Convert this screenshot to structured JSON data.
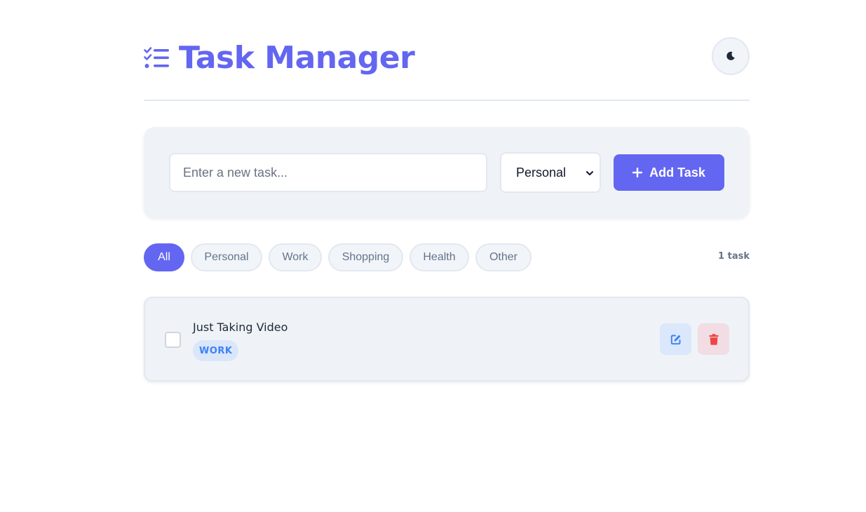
{
  "header": {
    "title": "Task Manager",
    "title_icon": "task-list-icon",
    "theme_toggle_icon": "moon-icon"
  },
  "add_task": {
    "input_placeholder": "Enter a new task...",
    "input_value": "",
    "category_selected": "Personal",
    "button_label": "Add Task",
    "button_icon": "plus-icon"
  },
  "filters": {
    "items": [
      {
        "label": "All",
        "active": true
      },
      {
        "label": "Personal",
        "active": false
      },
      {
        "label": "Work",
        "active": false
      },
      {
        "label": "Shopping",
        "active": false
      },
      {
        "label": "Health",
        "active": false
      },
      {
        "label": "Other",
        "active": false
      }
    ],
    "task_count": "1 task"
  },
  "tasks": [
    {
      "title": "Just Taking Video",
      "category": "WORK",
      "completed": false,
      "edit_icon": "edit-icon",
      "delete_icon": "trash-icon"
    }
  ],
  "colors": {
    "accent": "#6366f1",
    "panel": "#eff3f8",
    "work_tag_text": "#3b82f6",
    "delete": "#ef4444"
  }
}
